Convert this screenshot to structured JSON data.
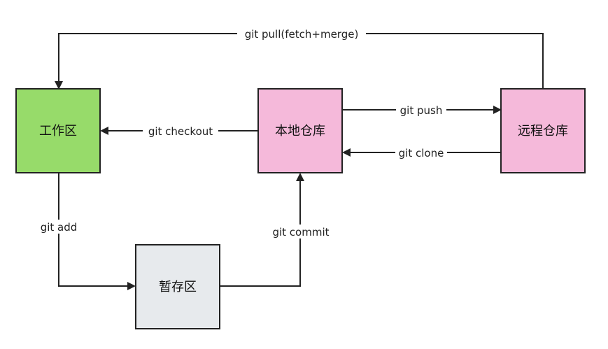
{
  "nodes": {
    "working_dir": {
      "label": "工作区",
      "fill": "#97db6a"
    },
    "local_repo": {
      "label": "本地仓库",
      "fill": "#f5b9da"
    },
    "remote_repo": {
      "label": "远程仓库",
      "fill": "#f5b9da"
    },
    "staging_area": {
      "label": "暂存区",
      "fill": "#e7eaed"
    }
  },
  "edges": {
    "pull": "git pull(fetch+merge)",
    "checkout": "git checkout",
    "push": "git push",
    "clone": "git clone",
    "add": "git add",
    "commit": "git commit"
  },
  "colors": {
    "stroke": "#222222",
    "background": "#ffffff"
  }
}
